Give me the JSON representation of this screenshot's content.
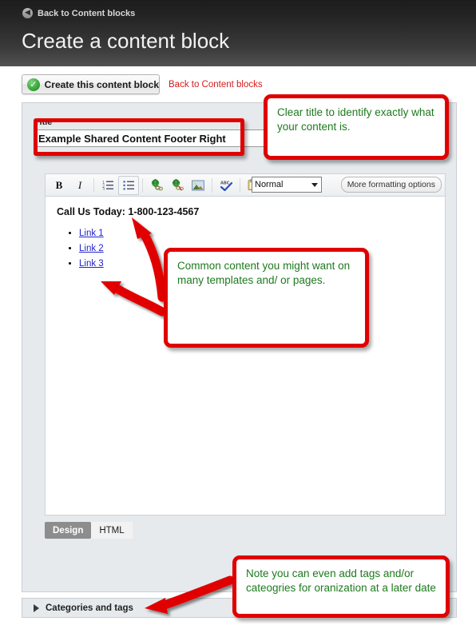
{
  "header": {
    "back_link": "Back to Content blocks",
    "back_icon": "arrow-left-circle-icon",
    "title": "Create a content block"
  },
  "action_bar": {
    "create_button": "Create this content block",
    "create_icon": "green-check-icon",
    "back_link": "Back to Content blocks",
    "link_color": "#d61c1c"
  },
  "form": {
    "title_label": "Title",
    "title_value": "Example Shared Content Footer Right",
    "title_placeholder": ""
  },
  "editor": {
    "toolbar": [
      {
        "name": "bold-icon",
        "label": "B"
      },
      {
        "name": "italic-icon",
        "label": "I"
      },
      {
        "name": "ordered-list-icon",
        "label": ""
      },
      {
        "name": "unordered-list-icon",
        "label": ""
      },
      {
        "name": "insert-link-icon",
        "label": ""
      },
      {
        "name": "remove-link-icon",
        "label": ""
      },
      {
        "name": "insert-image-icon",
        "label": ""
      },
      {
        "name": "spellcheck-icon",
        "label": ""
      },
      {
        "name": "paste-from-word-icon",
        "label": ""
      }
    ],
    "format_select_value": "Normal",
    "format_select_options": [
      "Normal"
    ],
    "more_formatting_button": "More formatting options",
    "content": {
      "phone_line": "Call Us Today: 1-800-123-4567",
      "links": [
        "Link 1",
        "Link 2",
        "Link 3"
      ],
      "link_color": "#2222cc"
    },
    "tabs": [
      {
        "label": "Design",
        "active": true
      },
      {
        "label": "HTML",
        "active": false
      }
    ]
  },
  "categories": {
    "label": "Categories and tags",
    "expander_icon": "triangle-right-icon"
  },
  "annotations": [
    {
      "id": "title-note",
      "text": "Clear title to identify exactly what your content is."
    },
    {
      "id": "content-note",
      "text": "Common content you might want on many templates and/ or pages."
    },
    {
      "id": "categories-note",
      "text": "Note you can even add tags and/or cateogries for oranization at a later date"
    }
  ],
  "annotation_style": {
    "border_color": "#e00000",
    "text_color": "#1d7a1d",
    "arrow_color": "#e00000"
  }
}
